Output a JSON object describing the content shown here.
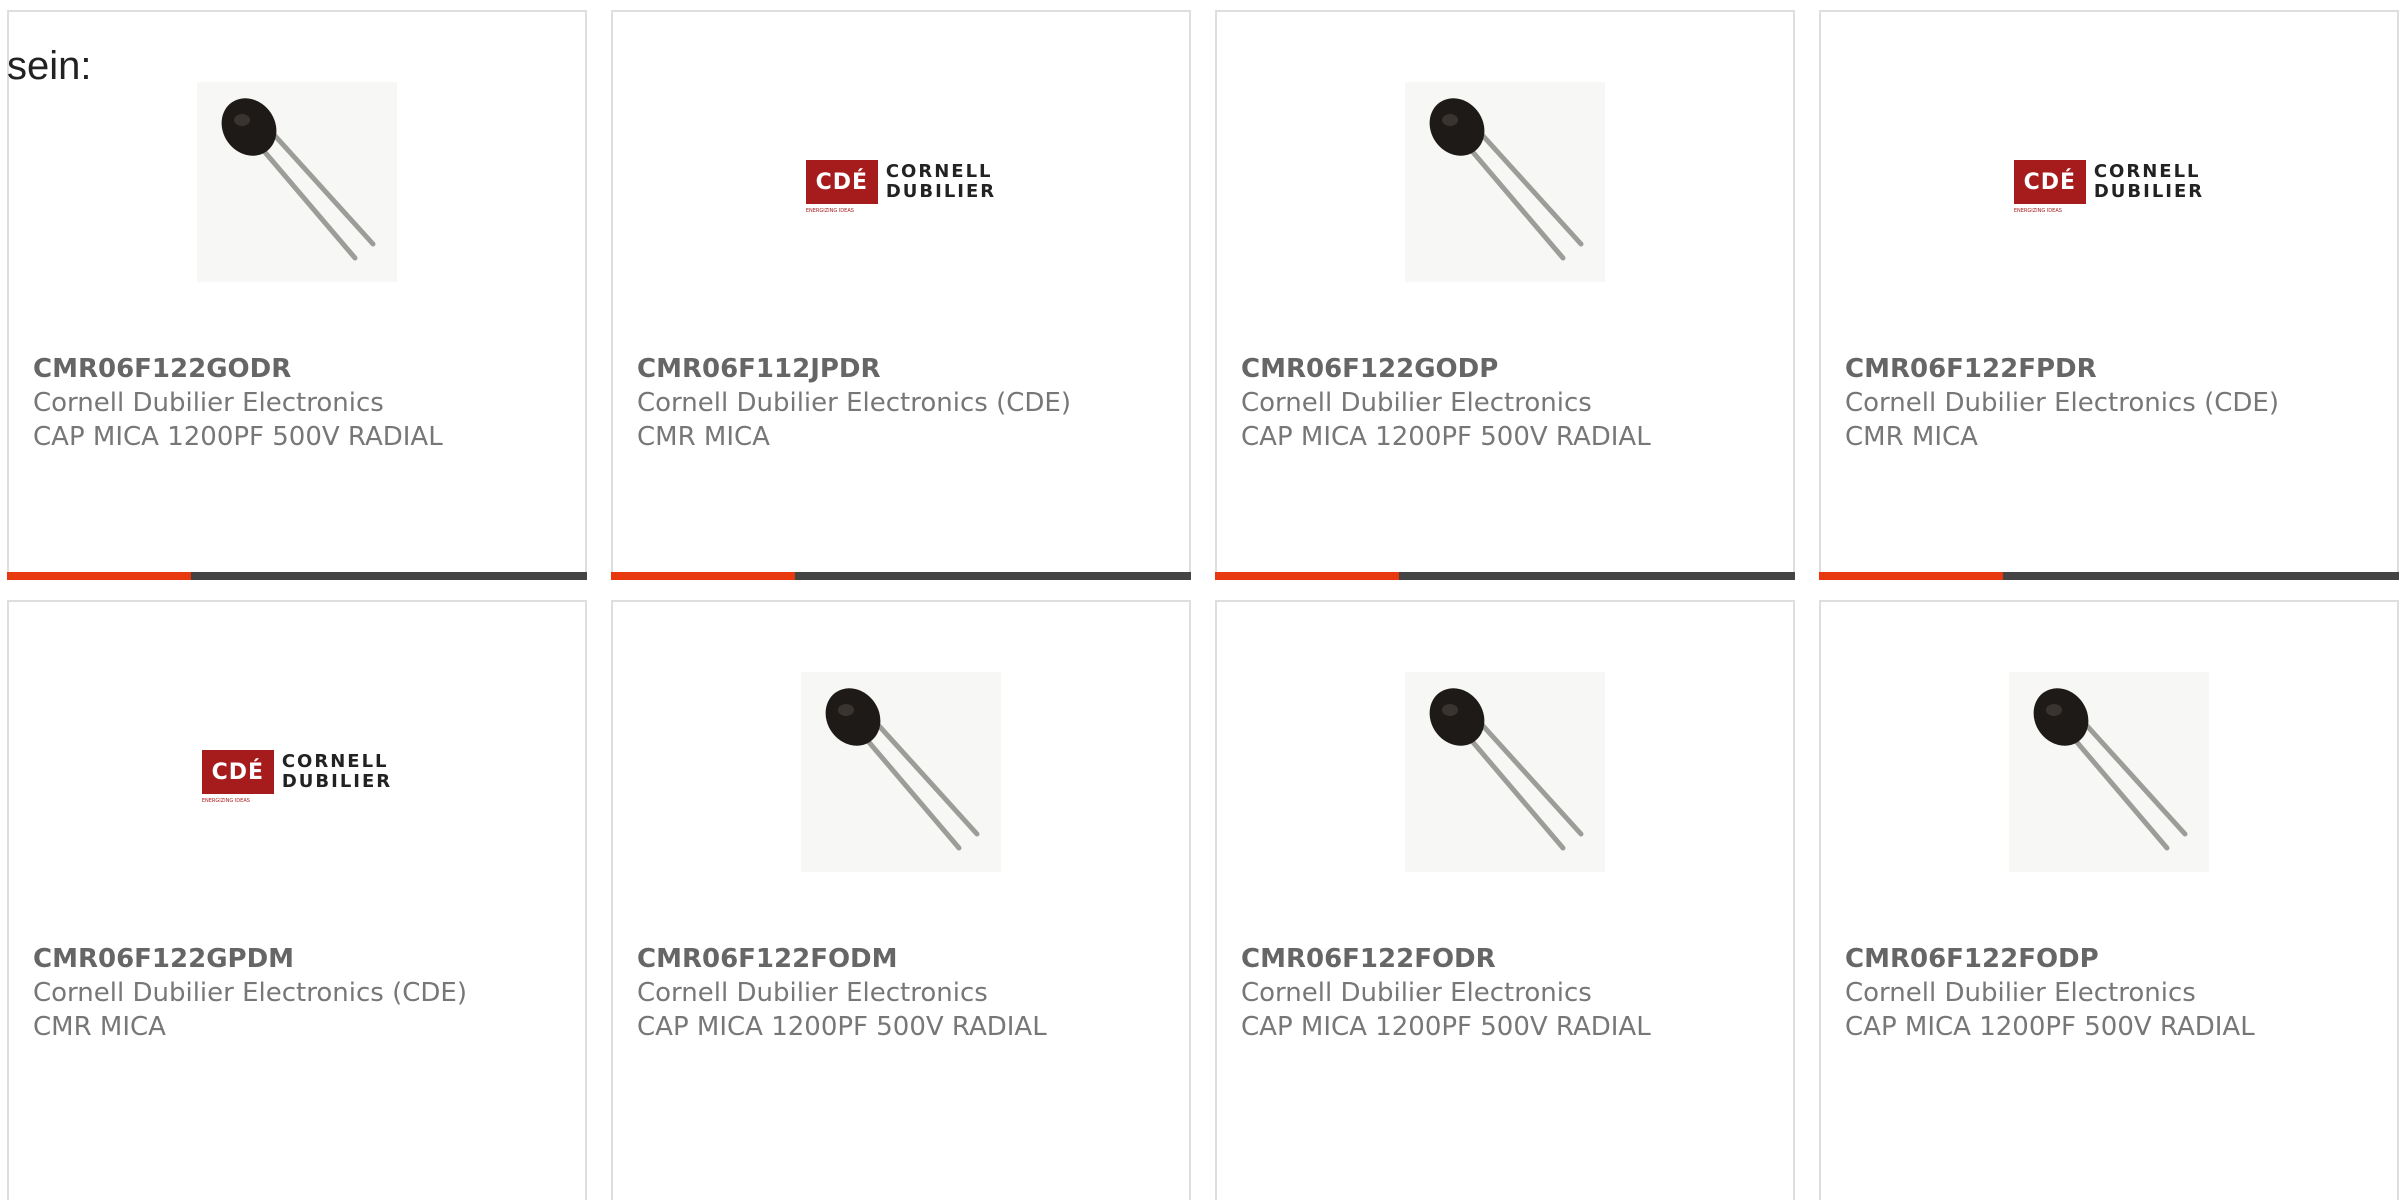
{
  "intro_text": "sein:",
  "logo": {
    "mark": "CDÉ",
    "tagline": "ENERGIZING IDEAS",
    "line1": "CORNELL",
    "line2": "DUBILIER"
  },
  "products": [
    {
      "part": "CMR06F122GODR",
      "maker": "Cornell Dubilier Electronics",
      "desc": "CAP MICA 1200PF 500V RADIAL",
      "image": "capacitor-photo"
    },
    {
      "part": "CMR06F112JPDR",
      "maker": "Cornell Dubilier Electronics (CDE)",
      "desc": "CMR MICA",
      "image": "cde-logo"
    },
    {
      "part": "CMR06F122GODP",
      "maker": "Cornell Dubilier Electronics",
      "desc": "CAP MICA 1200PF 500V RADIAL",
      "image": "capacitor-photo"
    },
    {
      "part": "CMR06F122FPDR",
      "maker": "Cornell Dubilier Electronics (CDE)",
      "desc": "CMR MICA",
      "image": "cde-logo"
    },
    {
      "part": "CMR06F122GPDM",
      "maker": "Cornell Dubilier Electronics (CDE)",
      "desc": "CMR MICA",
      "image": "cde-logo"
    },
    {
      "part": "CMR06F122FODM",
      "maker": "Cornell Dubilier Electronics",
      "desc": "CAP MICA 1200PF 500V RADIAL",
      "image": "capacitor-photo"
    },
    {
      "part": "CMR06F122FODR",
      "maker": "Cornell Dubilier Electronics",
      "desc": "CAP MICA 1200PF 500V RADIAL",
      "image": "capacitor-photo"
    },
    {
      "part": "CMR06F122FODP",
      "maker": "Cornell Dubilier Electronics",
      "desc": "CAP MICA 1200PF 500V RADIAL",
      "image": "capacitor-photo"
    }
  ],
  "colors": {
    "accent": "#e8380d",
    "bar": "#444444",
    "logo_red": "#a61c1c"
  }
}
